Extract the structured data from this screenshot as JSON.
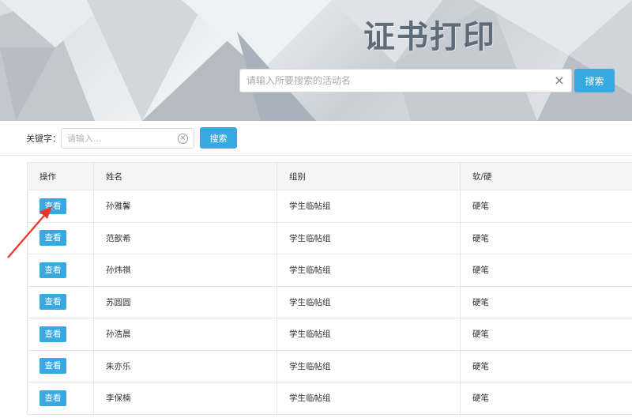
{
  "banner": {
    "title": "证书打印",
    "search_placeholder": "请输入所要搜索的活动名",
    "clear_icon": "×",
    "search_button": "搜索"
  },
  "filter": {
    "label": "关键字：",
    "placeholder": "请输入...",
    "clear_icon": "⊗",
    "search_button": "搜索"
  },
  "table": {
    "headers": [
      "操作",
      "姓名",
      "组别",
      "软/硬"
    ],
    "view_label": "查看",
    "rows": [
      {
        "name": "孙雅馨",
        "group": "学生临帖组",
        "type": "硬笔"
      },
      {
        "name": "范歆希",
        "group": "学生临帖组",
        "type": "硬笔"
      },
      {
        "name": "孙炜祺",
        "group": "学生临帖组",
        "type": "硬笔"
      },
      {
        "name": "苏圆圆",
        "group": "学生临帖组",
        "type": "硬笔"
      },
      {
        "name": "孙浩晨",
        "group": "学生临帖组",
        "type": "硬笔"
      },
      {
        "name": "朱亦乐",
        "group": "学生临帖组",
        "type": "硬笔"
      },
      {
        "name": "李保楠",
        "group": "学生临帖组",
        "type": "硬笔"
      }
    ]
  },
  "colors": {
    "accent": "#36a9e1",
    "annotation_arrow": "#e8352a"
  }
}
